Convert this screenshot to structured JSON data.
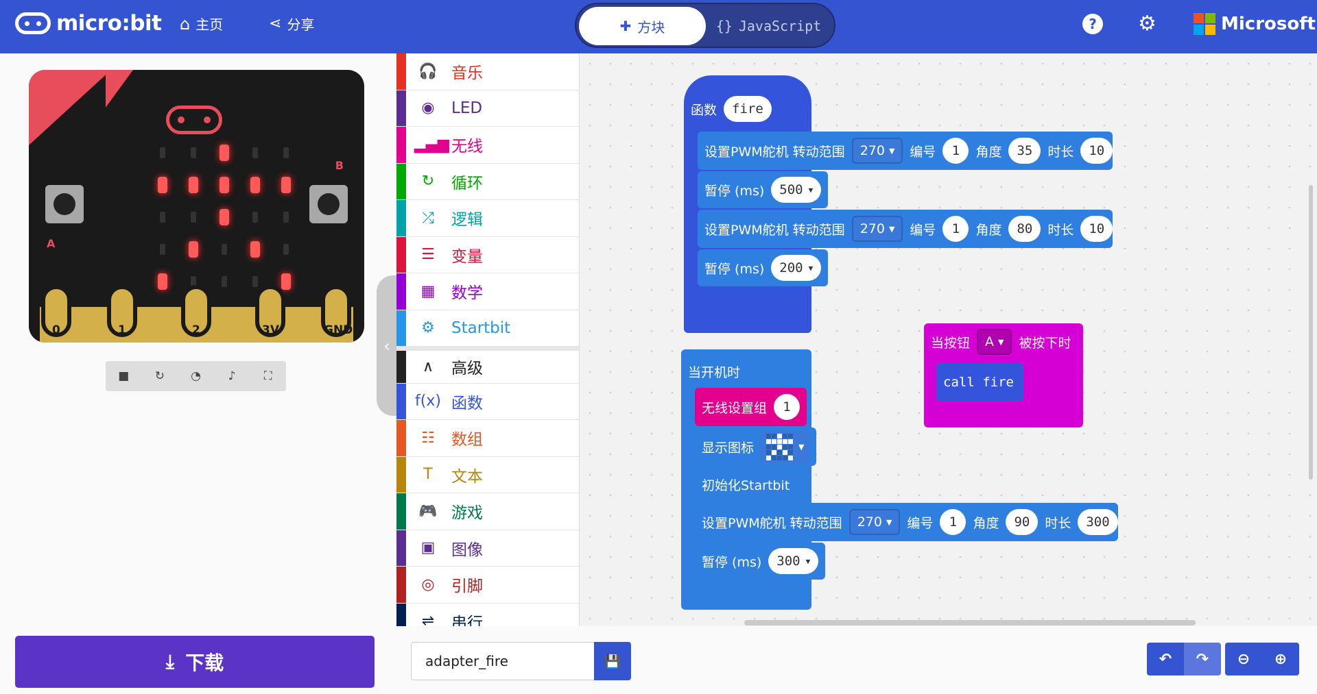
{
  "header": {
    "logo": "micro:bit",
    "home": "主页",
    "share": "分享",
    "tab_blocks": "方块",
    "tab_js": "JavaScript",
    "help": "?",
    "brand": "Microsoft"
  },
  "simulator": {
    "pins": [
      "0",
      "1",
      "2",
      "3V",
      "GND"
    ],
    "button_a": "A",
    "button_b": "B"
  },
  "download_label": "下载",
  "toolbox": [
    {
      "label": "音乐",
      "color": "#e63022",
      "icon": "headphones-icon",
      "glyph": "🎧"
    },
    {
      "label": "LED",
      "color": "#5c2d91",
      "icon": "toggle-icon",
      "glyph": "◉"
    },
    {
      "label": "无线",
      "color": "#e3008c",
      "icon": "signal-bars-icon",
      "glyph": "▂▄▆"
    },
    {
      "label": "循环",
      "color": "#00aa00",
      "icon": "loop-icon",
      "glyph": "↻"
    },
    {
      "label": "逻辑",
      "color": "#00a4a6",
      "icon": "shuffle-icon",
      "glyph": "⤮"
    },
    {
      "label": "变量",
      "color": "#dc143c",
      "icon": "lines-icon",
      "glyph": "☰"
    },
    {
      "label": "数学",
      "color": "#9400d3",
      "icon": "calculator-icon",
      "glyph": "▦"
    },
    {
      "label": "Startbit",
      "color": "#2696e8",
      "icon": "gear-icon",
      "glyph": "⚙"
    },
    {
      "label": "高级",
      "color": "#222222",
      "icon": "chevron-up-icon",
      "glyph": "∧"
    },
    {
      "label": "函数",
      "color": "#3455db",
      "icon": "function-icon",
      "glyph": "f(x)"
    },
    {
      "label": "数组",
      "color": "#e65722",
      "icon": "list-icon",
      "glyph": "☷"
    },
    {
      "label": "文本",
      "color": "#b8860b",
      "icon": "text-icon",
      "glyph": "T"
    },
    {
      "label": "游戏",
      "color": "#007a4b",
      "icon": "gamepad-icon",
      "glyph": "🎮"
    },
    {
      "label": "图像",
      "color": "#5c2d91",
      "icon": "image-icon",
      "glyph": "▣"
    },
    {
      "label": "引脚",
      "color": "#b22222",
      "icon": "target-icon",
      "glyph": "◎"
    },
    {
      "label": "串行",
      "color": "#002050",
      "icon": "usb-icon",
      "glyph": "⇌"
    }
  ],
  "blocks": {
    "func_label": "函数",
    "func_name": "fire",
    "servo": "设置PWM舵机 转动范围",
    "num_label": "编号",
    "angle_label": "角度",
    "dur_label": "时长",
    "pause": "暂停 (ms)",
    "f1": {
      "range": "270",
      "num": "1",
      "angle": "35",
      "dur": "10"
    },
    "p1": "500",
    "f2": {
      "range": "270",
      "num": "1",
      "angle": "80",
      "dur": "10"
    },
    "p2": "200",
    "start": "当开机时",
    "radio": "无线设置组",
    "radio_val": "1",
    "show_icon": "显示图标",
    "init": "初始化Startbit",
    "s1": {
      "range": "270",
      "num": "1",
      "angle": "90",
      "dur": "300"
    },
    "p3": "300",
    "btn_event": "当按钮",
    "btn_val": "A",
    "btn_pressed": "被按下时",
    "call": "call fire"
  },
  "project_name": "adapter_fire"
}
